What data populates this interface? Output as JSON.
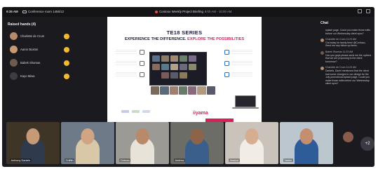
{
  "topbar": {
    "time": "9:35 AM",
    "room": "Conference room 1456/12",
    "meeting_title": "Contoso Weekly Project Briefing",
    "meeting_time": "9:00 AM - 10:00 AM"
  },
  "raised_hands": {
    "title": "Raised hands (4)",
    "people": [
      {
        "name": "Charlotte de Crum",
        "color": "#b58b6c"
      },
      {
        "name": "Aaron Buxton",
        "color": "#c79a74"
      },
      {
        "name": "Babek Shamas",
        "color": "#6f5a4f"
      },
      {
        "name": "Kayo Miwa",
        "color": "#3d3d44"
      }
    ],
    "hand_glyph": "✋"
  },
  "presentation": {
    "title": "TE18 SERIES",
    "subtitle_plain": "EXPERIENCE THE DIFFERENCE.",
    "subtitle_accent": "EXPLORE THE POSSIBILITIES",
    "brand": "iiyama",
    "accent_color": "#d5205a"
  },
  "chat": {
    "title": "Chat",
    "messages": [
      {
        "sender": "",
        "text": "splash page. Could you make those edits before our Wednesday client sync?",
        "color": "#b58b6c"
      },
      {
        "sender": "Charlotte de Crum 11:23 AM",
        "text": "Out today for family time! @Contoso, Send me any follow up items.",
        "color": "#b58b6c"
      },
      {
        "sender": "Babek Shamas 11:23 AM",
        "text": "Can you guys please send me the options that we are proposing to the client tomorrow?",
        "color": "#6f5a4f"
      },
      {
        "sender": "Charlotte de Crum 11:23 AM",
        "text": "Daniela, Dachi mentioned that the client had some changes to our design for the July promotional splash page. Could you make those edits before our Wednesday client sync?",
        "color": "#b58b6c"
      }
    ]
  },
  "participants": [
    {
      "name": "Anthony Daniels",
      "bg": "#3f3526",
      "skin": "#c69a76",
      "shirt": "#2f3a4c"
    },
    {
      "name": "Griffith",
      "bg": "#6e7a88",
      "skin": "#d1a584",
      "shirt": "#d8c8a8"
    },
    {
      "name": "Odessa",
      "bg": "#9c9a94",
      "skin": "#b98a6a",
      "shirt": "#e8e3d8"
    },
    {
      "name": "Andrew",
      "bg": "#6d6d68",
      "skin": "#8e6448",
      "shirt": "#3a5f8a"
    },
    {
      "name": "Jessica",
      "bg": "#c9c3bc",
      "skin": "#d7ad91",
      "shirt": "#f1ece4"
    },
    {
      "name": "Varlen",
      "bg": "#bcc6cf",
      "skin": "#c48f6e",
      "shirt": "#2d5c99"
    }
  ],
  "overflow_count": "+2"
}
